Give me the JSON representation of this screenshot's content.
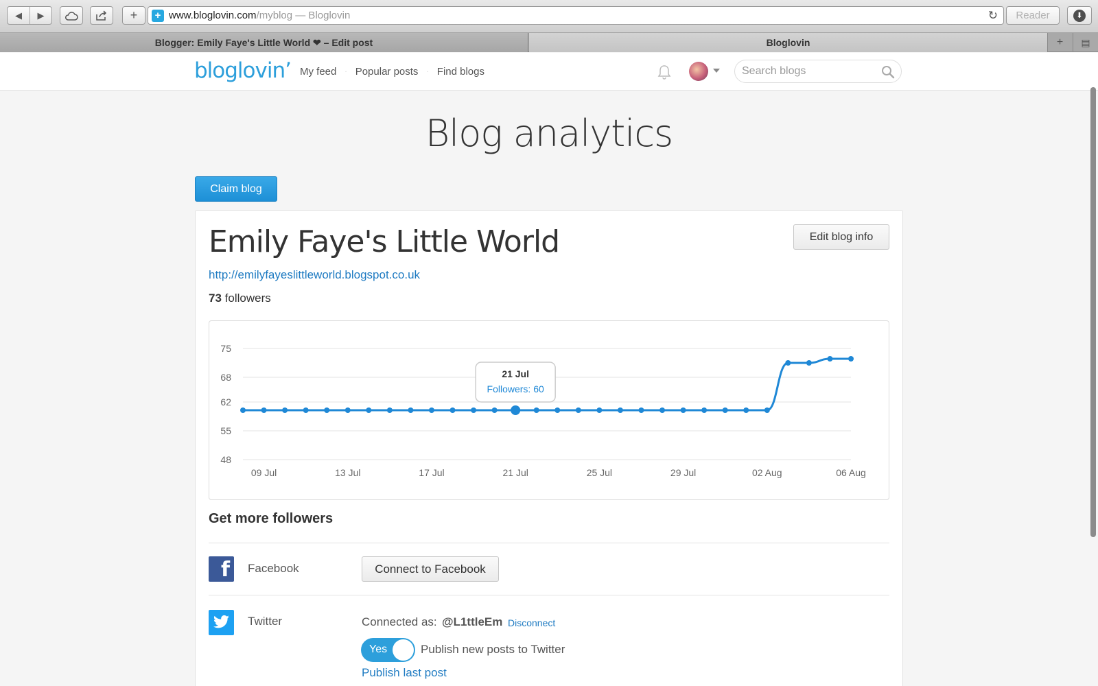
{
  "browser": {
    "url_host": "www.bloglovin.com",
    "url_path": "/myblog",
    "url_title": "— Bloglovin",
    "reader_label": "Reader",
    "tabs": [
      {
        "label": "Blogger: Emily Faye's Little World ❤ – Edit post"
      },
      {
        "label": "Bloglovin"
      }
    ]
  },
  "header": {
    "logo": "bloglovin’",
    "nav": [
      {
        "label": "My feed"
      },
      {
        "label": "Popular posts"
      },
      {
        "label": "Find blogs"
      }
    ],
    "search_placeholder": "Search blogs"
  },
  "page": {
    "title": "Blog analytics",
    "claim_button": "Claim blog"
  },
  "blog": {
    "name": "Emily Faye's Little World",
    "edit_button": "Edit blog info",
    "url": "http://emilyfayeslittleworld.blogspot.co.uk",
    "followers_count": "73",
    "followers_label": "followers"
  },
  "chart_data": {
    "type": "line",
    "title": "",
    "xlabel": "",
    "ylabel": "",
    "x_ticks": [
      "09 Jul",
      "13 Jul",
      "17 Jul",
      "21 Jul",
      "25 Jul",
      "29 Jul",
      "02 Aug",
      "06 Aug"
    ],
    "y_ticks": [
      75,
      68,
      62,
      55,
      48
    ],
    "ylim": [
      48,
      75
    ],
    "grid": true,
    "x": [
      "08 Jul",
      "09 Jul",
      "10 Jul",
      "11 Jul",
      "12 Jul",
      "13 Jul",
      "14 Jul",
      "15 Jul",
      "16 Jul",
      "17 Jul",
      "18 Jul",
      "19 Jul",
      "20 Jul",
      "21 Jul",
      "22 Jul",
      "23 Jul",
      "24 Jul",
      "25 Jul",
      "26 Jul",
      "27 Jul",
      "28 Jul",
      "29 Jul",
      "30 Jul",
      "31 Jul",
      "01 Aug",
      "02 Aug",
      "03 Aug",
      "04 Aug",
      "05 Aug",
      "06 Aug"
    ],
    "series": [
      {
        "color": "#1f88d6",
        "values": [
          60,
          60,
          60,
          60,
          60,
          60,
          60,
          60,
          60,
          60,
          60,
          60,
          60,
          60,
          60,
          60,
          60,
          60,
          60,
          60,
          60,
          60,
          60,
          60,
          60,
          60,
          71.5,
          71.5,
          72.5,
          72.5
        ]
      }
    ],
    "tooltip": {
      "date": "21 Jul",
      "label": "Followers: 60"
    }
  },
  "followers_section": {
    "title": "Get more followers",
    "facebook": {
      "label": "Facebook",
      "button": "Connect to Facebook"
    },
    "twitter": {
      "label": "Twitter",
      "connected_label": "Connected as:",
      "handle": "@L1ttleEm",
      "disconnect": "Disconnect",
      "toggle_state": "Yes",
      "toggle_text": "Publish new posts to Twitter",
      "publish_last": "Publish last post"
    }
  },
  "colors": {
    "brand": "#2d9fdb",
    "link": "#1f7bc2",
    "facebook": "#3b5998",
    "twitter": "#1da1f2"
  }
}
